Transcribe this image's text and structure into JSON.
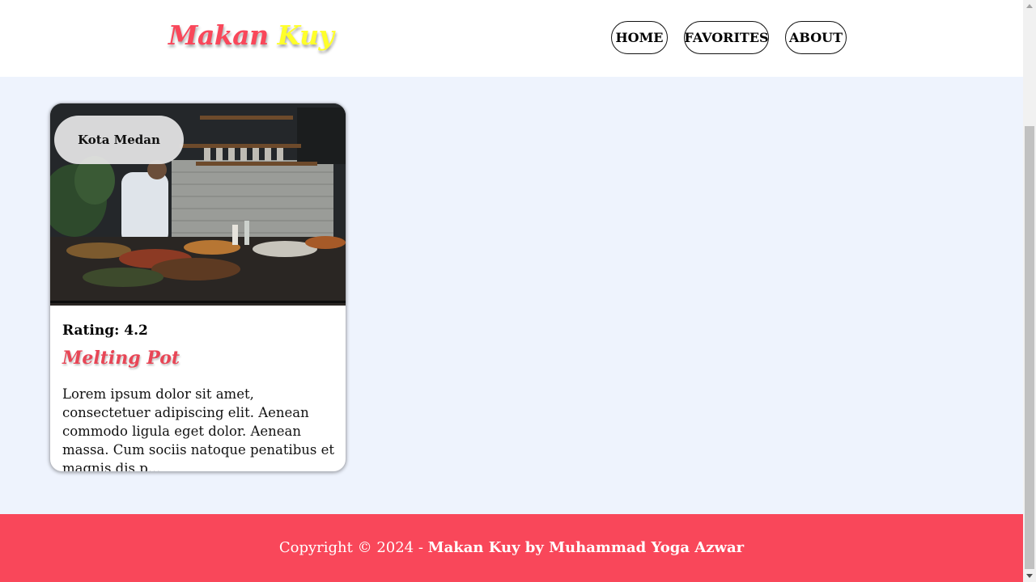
{
  "header": {
    "brand_part1": "Makan",
    "brand_part2": "Kuy",
    "nav": [
      {
        "label": "HOME"
      },
      {
        "label": "FAVORITES"
      },
      {
        "label": "ABOUT"
      }
    ]
  },
  "restaurants": [
    {
      "city": "Kota Medan",
      "rating_text": "Rating: 4.2",
      "name": "Melting Pot",
      "description": "Lorem ipsum dolor sit amet, consectetuer adipiscing elit. Aenean commodo ligula eget dolor. Aenean massa. Cum sociis natoque penatibus et magnis dis p..."
    }
  ],
  "footer": {
    "prefix": "Copyright © 2024 - ",
    "bold": "Makan Kuy by Muhammad Yoga Azwar"
  },
  "colors": {
    "brand_red": "#f9475a",
    "brand_yellow": "#ffff2a",
    "background": "#eef3fd",
    "title_red": "#e84656"
  }
}
